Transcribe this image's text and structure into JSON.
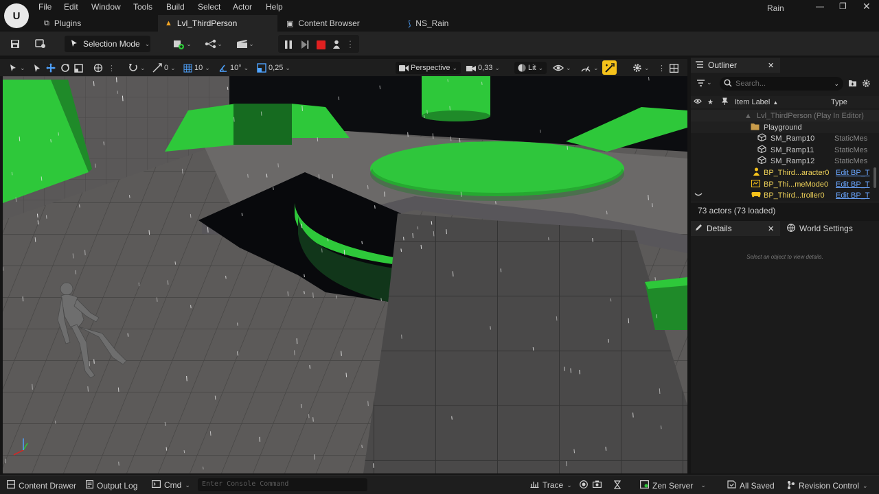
{
  "menu": {
    "items": [
      "File",
      "Edit",
      "Window",
      "Tools",
      "Build",
      "Select",
      "Actor",
      "Help"
    ],
    "project_name": "Rain",
    "logo_label": "U"
  },
  "tabs": [
    {
      "label": "Plugins",
      "icon": "plugin-icon"
    },
    {
      "label": "Lvl_ThirdPerson",
      "icon": "level-warning-icon"
    },
    {
      "label": "Content Browser",
      "icon": "content-browser-icon"
    },
    {
      "label": "NS_Rain",
      "icon": "niagara-icon"
    }
  ],
  "toolbar": {
    "selection_mode": "Selection Mode"
  },
  "viewport_toolbar": {
    "translate_snap": "0",
    "grid_snap": "10",
    "rotation_snap": "10°",
    "scale_snap": "0,25",
    "view_mode_projection": "Perspective",
    "camera_speed": "0,33",
    "lighting": "Lit"
  },
  "outliner": {
    "title": "Outliner",
    "search_placeholder": "Search...",
    "col_label": "Item Label",
    "col_type": "Type",
    "rows": [
      {
        "label": "Lvl_ThirdPerson (Play In Editor)",
        "type": ""
      },
      {
        "label": "Playground",
        "type": ""
      },
      {
        "label": "SM_Ramp10",
        "type": "StaticMes"
      },
      {
        "label": "SM_Ramp11",
        "type": "StaticMes"
      },
      {
        "label": "SM_Ramp12",
        "type": "StaticMes"
      },
      {
        "label": "BP_Third...aracter0",
        "type": "Edit BP_T"
      },
      {
        "label": "BP_Thi...meMode0",
        "type": "Edit BP_T"
      },
      {
        "label": "BP_Third...troller0",
        "type": "Edit BP_T"
      }
    ],
    "actor_count": "73 actors (73 loaded)"
  },
  "details": {
    "title": "Details",
    "world_settings": "World Settings",
    "empty_message": "Select an object to view details."
  },
  "statusbar": {
    "content_drawer": "Content Drawer",
    "output_log": "Output Log",
    "cmd": "Cmd",
    "console_placeholder": "Enter Console Command",
    "trace": "Trace",
    "zen_server": "Zen Server",
    "all_saved": "All Saved",
    "revision_control": "Revision Control"
  },
  "colors": {
    "accent_green": "#2ec83a",
    "accent_yellow": "#f5c21b",
    "stop_red": "#e02020",
    "link_blue": "#6aa6ff"
  }
}
